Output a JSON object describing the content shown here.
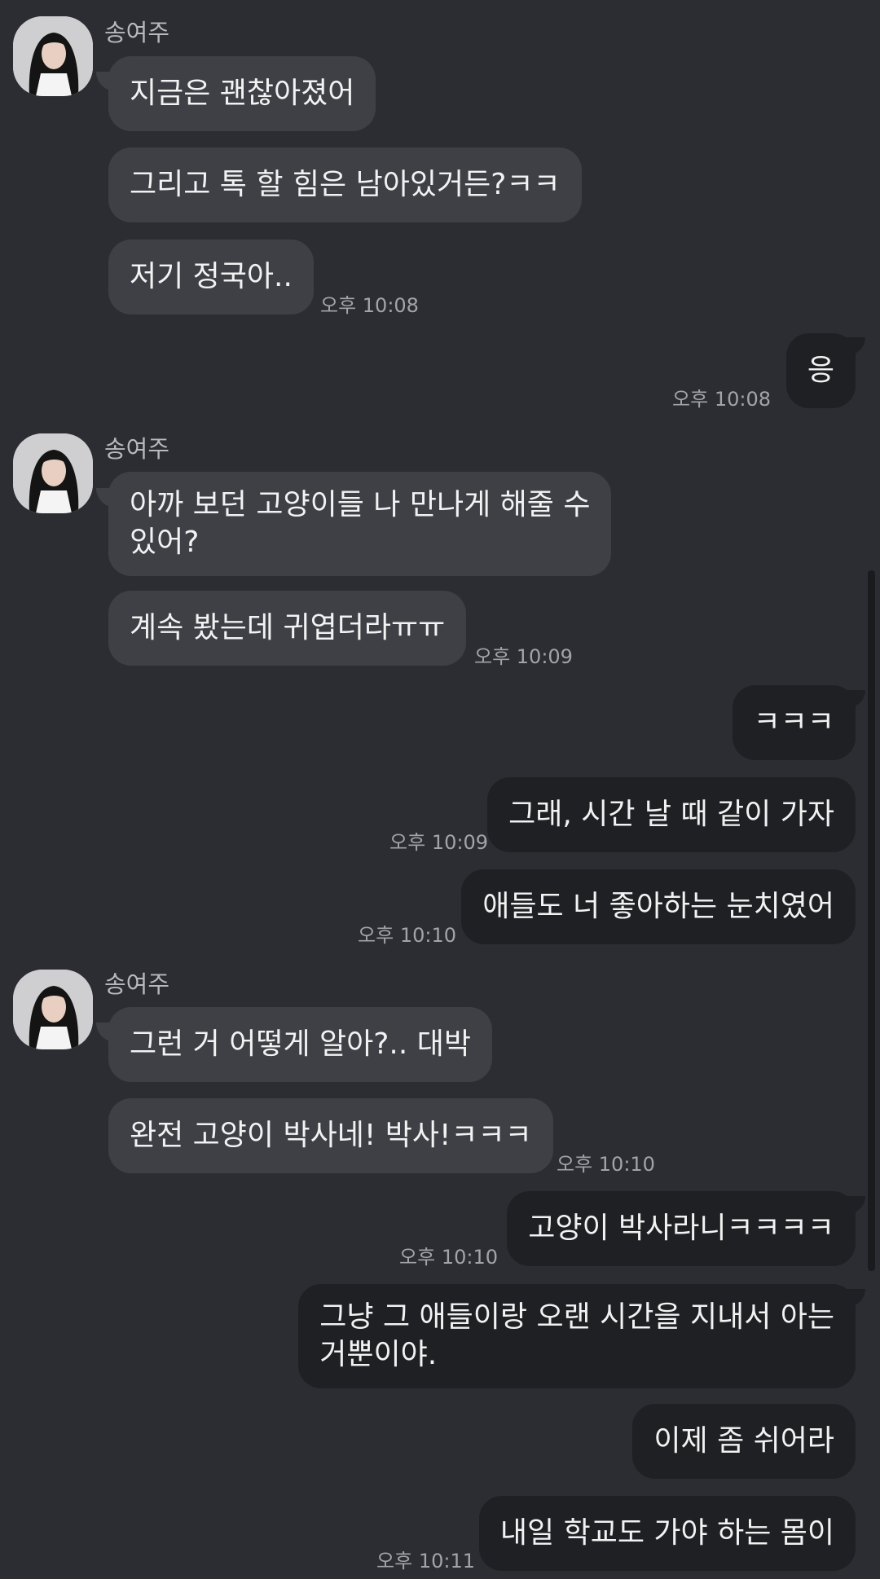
{
  "sender_name": "송여주",
  "messages": [
    {
      "text": "지금은 괜찮아졌어"
    },
    {
      "text": "그리고 톡 할 힘은 남아있거든?ㅋㅋ"
    },
    {
      "text": "저기 정국아..",
      "time": "오후 10:08"
    },
    {
      "text": "응",
      "time": "오후 10:08"
    },
    {
      "text": "아까 보던 고양이들 나 만나게 해줄 수\n있어?"
    },
    {
      "text": "계속 봤는데 귀엽더라ㅠㅠ",
      "time": "오후 10:09"
    },
    {
      "text": "ㅋㅋㅋ"
    },
    {
      "text": "그래, 시간 날 때 같이 가자",
      "time": "오후 10:09"
    },
    {
      "text": "애들도 너 좋아하는 눈치였어",
      "time": "오후 10:10"
    },
    {
      "text": "그런 거 어떻게 알아?.. 대박"
    },
    {
      "text": "완전 고양이 박사네! 박사!ㅋㅋㅋ",
      "time": "오후 10:10"
    },
    {
      "text": "고양이 박사라니ㅋㅋㅋㅋ",
      "time": "오후 10:10"
    },
    {
      "text": "그냥 그 애들이랑 오랜 시간을 지내서 아는\n거뿐이야."
    },
    {
      "text": "이제 좀 쉬어라"
    },
    {
      "text": "내일 학교도 가야 하는 몸이",
      "time": "오후 10:11"
    }
  ],
  "colors": {
    "background": "#2b2d33",
    "incoming_bubble": "#3e4046",
    "outgoing_bubble": "#1f2024",
    "timestamp": "#a3a4a8"
  }
}
